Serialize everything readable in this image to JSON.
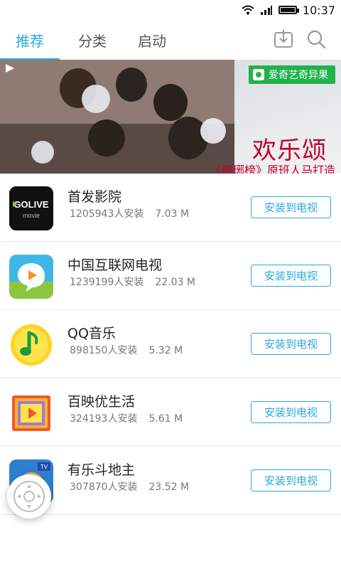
{
  "status_bar": {
    "time": "10:37",
    "icons": [
      "wifi-icon",
      "signal-icon",
      "battery-icon"
    ]
  },
  "tabs": [
    {
      "label": "推荐",
      "active": true
    },
    {
      "label": "分类",
      "active": false
    },
    {
      "label": "启动",
      "active": false
    }
  ],
  "toolbar_icons": [
    "download-icon",
    "search-icon"
  ],
  "banner": {
    "badge": "爱奇艺奇异果",
    "title": "欢乐颂",
    "subtitle": "《琅琊榜》原班人马打造"
  },
  "apps": [
    {
      "name": "首发影院",
      "installs": "1205943人安装",
      "size": "7.03 M",
      "button": "安装到电视",
      "icon": "golive-movie-icon"
    },
    {
      "name": "中国互联网电视",
      "installs": "1239199人安装",
      "size": "22.03 M",
      "button": "安装到电视",
      "icon": "play-bubble-icon"
    },
    {
      "name": "QQ音乐",
      "installs": "898150人安装",
      "size": "5.32 M",
      "button": "安装到电视",
      "icon": "music-note-icon"
    },
    {
      "name": "百映优生活",
      "installs": "324193人安装",
      "size": "5.61 M",
      "button": "安装到电视",
      "icon": "colorful-play-icon"
    },
    {
      "name": "有乐斗地主",
      "installs": "307870人安装",
      "size": "23.52 M",
      "button": "安装到电视",
      "icon": "cartoon-game-icon"
    }
  ],
  "colors": {
    "accent": "#2aa7df",
    "banner_title": "#c3002a",
    "badge_green": "#22b24c"
  }
}
